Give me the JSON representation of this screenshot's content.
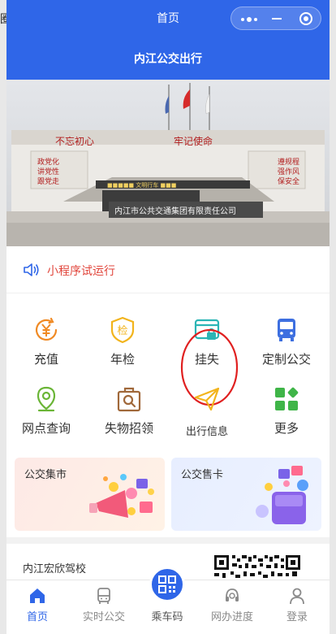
{
  "topbar": {
    "title": "首页"
  },
  "header": {
    "title": "内江公交出行"
  },
  "banner": {
    "slogan_left": "不忘初心",
    "slogan_right": "牢记使命",
    "left_board": [
      "政党化",
      "讲党性",
      "跟党走"
    ],
    "right_board": [
      "遵规程",
      "强作风",
      "保安全"
    ],
    "company_sign": "内江市公共交通集团有限责任公司",
    "gate_sign": "■■■■■ 文明行车 ■■■"
  },
  "notice": {
    "text": "小程序试运行"
  },
  "grid": {
    "row1": [
      {
        "label": "充值",
        "icon": "yuan-icon"
      },
      {
        "label": "年检",
        "icon": "shield-check-icon"
      },
      {
        "label": "挂失",
        "icon": "card-lock-icon"
      },
      {
        "label": "定制公交",
        "icon": "bus-icon"
      }
    ],
    "row2": [
      {
        "label": "网点查询",
        "icon": "location-icon"
      },
      {
        "label": "失物招领",
        "icon": "bag-search-icon"
      },
      {
        "label": "出行信息",
        "icon": "paper-plane-icon"
      },
      {
        "label": "更多",
        "icon": "apps-icon"
      }
    ]
  },
  "cards": [
    {
      "title": "公交集市"
    },
    {
      "title": "公交售卡"
    }
  ],
  "extra": {
    "text": "内江宏欣驾校"
  },
  "tabs": [
    {
      "label": "首页"
    },
    {
      "label": "实时公交"
    },
    {
      "label": "乘车码"
    },
    {
      "label": "网办进度"
    },
    {
      "label": "登录"
    }
  ],
  "colors": {
    "primary": "#2f66e8",
    "notice": "#e1463c",
    "highlight": "#e02020"
  },
  "edge_fragment": "圈"
}
